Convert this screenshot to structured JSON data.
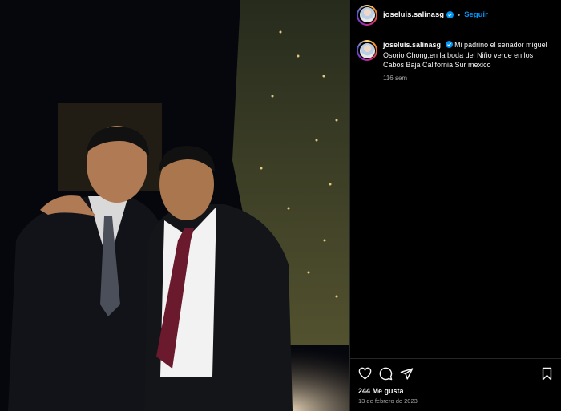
{
  "post": {
    "username": "joseluis.salinasg",
    "follow_label": "Seguir",
    "separator": "•",
    "caption": "Mi padrino el senador miguel Osorio Chong,en la boda del Niño verde en los Cabos Baja California Sur mexico",
    "time_ago": "116 sem",
    "likes": "244 Me gusta",
    "date": "13 de febrero de 2023"
  },
  "colors": {
    "background": "#000000",
    "link_blue": "#0095f6",
    "verified_blue": "#0095f6",
    "muted_text": "#a8a8a8"
  },
  "icons": {
    "header": [
      "verified-badge-icon"
    ],
    "actions": [
      "heart-icon",
      "comment-icon",
      "share-icon",
      "bookmark-icon"
    ]
  }
}
